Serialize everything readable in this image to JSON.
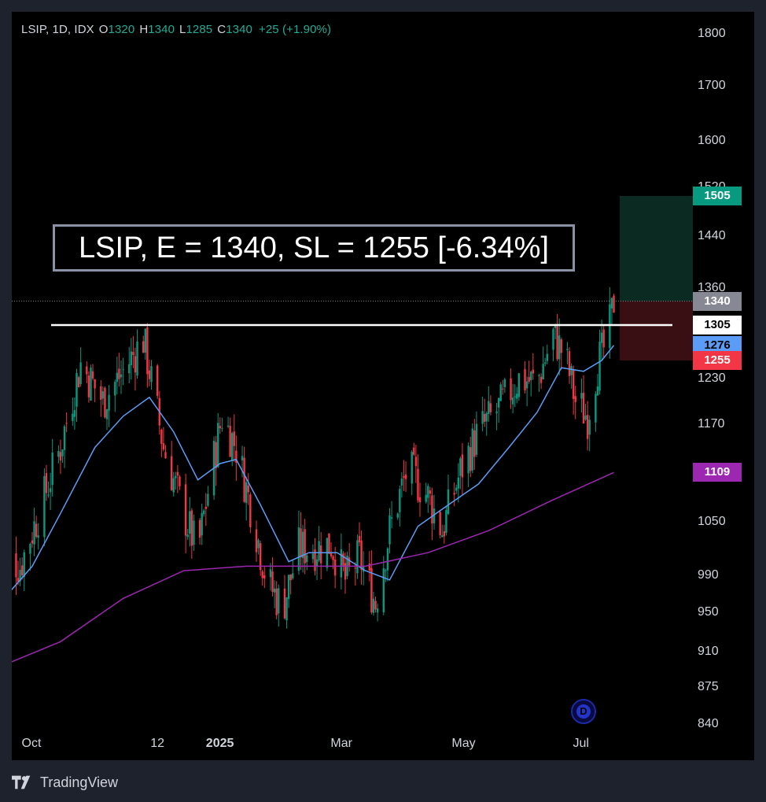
{
  "legend": {
    "symbol": "LSIP, 1D, IDX",
    "o_label": "O",
    "o_value": "1320",
    "h_label": "H",
    "h_value": "1340",
    "l_label": "L",
    "l_value": "1285",
    "c_label": "C",
    "c_value": "1340",
    "change": "+25 (+1.90%)"
  },
  "annotation": "LSIP, E = 1340, SL = 1255 [-6.34%]",
  "price_tags": [
    {
      "label": "1505",
      "value": 1505,
      "color": "#089981",
      "text_color": "#ffffff"
    },
    {
      "label": "1340",
      "value": 1340,
      "color": "#868993",
      "text_color": "#ffffff"
    },
    {
      "label": "1305",
      "value": 1305,
      "color": "#ffffff",
      "text_color": "#000000"
    },
    {
      "label": "1276",
      "value": 1276,
      "color": "#5b9cf6",
      "text_color": "#000000"
    },
    {
      "label": "1255",
      "value": 1255,
      "color": "#f23645",
      "text_color": "#ffffff"
    },
    {
      "label": "1109",
      "value": 1109,
      "color": "#9c27b0",
      "text_color": "#ffffff"
    }
  ],
  "footer": {
    "brand": "TradingView"
  },
  "colors": {
    "up": "#089981",
    "down": "#f23645",
    "ema_short": "#5b9cf6",
    "ema_long": "#9c27b0",
    "target_zone": "#0b2a22",
    "stop_zone": "#3a0f14",
    "resistance": "#ffffff"
  },
  "chart_data": {
    "type": "candlestick",
    "symbol": "LSIP",
    "interval": "1D",
    "exchange": "IDX",
    "y_scale": "log",
    "y_ticks": [
      {
        "label": "1800",
        "value": 1800
      },
      {
        "label": "1700",
        "value": 1700
      },
      {
        "label": "1600",
        "value": 1600
      },
      {
        "label": "1520",
        "value": 1520
      },
      {
        "label": "1440",
        "value": 1440
      },
      {
        "label": "1360",
        "value": 1360
      },
      {
        "label": "1230",
        "value": 1230
      },
      {
        "label": "1170",
        "value": 1170
      },
      {
        "label": "1050",
        "value": 1050
      },
      {
        "label": "990",
        "value": 990
      },
      {
        "label": "950",
        "value": 950
      },
      {
        "label": "910",
        "value": 910
      },
      {
        "label": "875",
        "value": 875
      },
      {
        "label": "840",
        "value": 840
      }
    ],
    "x_ticks": [
      {
        "label": "Oct",
        "date": "2024-10-01",
        "bold": false
      },
      {
        "label": "12",
        "date": "2024-12-02",
        "bold": false
      },
      {
        "label": "2025",
        "date": "2025-01-02",
        "bold": true
      },
      {
        "label": "Mar",
        "date": "2025-03-03",
        "bold": false
      },
      {
        "label": "May",
        "date": "2025-05-02",
        "bold": false
      },
      {
        "label": "Jul",
        "date": "2025-07-01",
        "bold": false
      }
    ],
    "resistance_level": 1305,
    "position": {
      "entry": 1340,
      "stop_loss": 1255,
      "target": 1505,
      "stop_pct": "-6.34%"
    },
    "close_series": [
      {
        "date": "2024-09-15",
        "close": 1020
      },
      {
        "date": "2024-09-25",
        "close": 1000
      },
      {
        "date": "2024-10-05",
        "close": 1065
      },
      {
        "date": "2024-10-15",
        "close": 1140
      },
      {
        "date": "2024-10-25",
        "close": 1250
      },
      {
        "date": "2024-11-05",
        "close": 1200
      },
      {
        "date": "2024-11-15",
        "close": 1240
      },
      {
        "date": "2024-11-25",
        "close": 1285
      },
      {
        "date": "2024-12-05",
        "close": 1140
      },
      {
        "date": "2024-12-15",
        "close": 1060
      },
      {
        "date": "2024-12-22",
        "close": 1015
      },
      {
        "date": "2024-12-28",
        "close": 1100
      },
      {
        "date": "2025-01-03",
        "close": 1180
      },
      {
        "date": "2025-01-10",
        "close": 1140
      },
      {
        "date": "2025-01-18",
        "close": 1060
      },
      {
        "date": "2025-01-25",
        "close": 985
      },
      {
        "date": "2025-02-02",
        "close": 955
      },
      {
        "date": "2025-02-10",
        "close": 1020
      },
      {
        "date": "2025-02-18",
        "close": 1020
      },
      {
        "date": "2025-02-26",
        "close": 1025
      },
      {
        "date": "2025-03-05",
        "close": 985
      },
      {
        "date": "2025-03-12",
        "close": 1010
      },
      {
        "date": "2025-03-20",
        "close": 960
      },
      {
        "date": "2025-03-27",
        "close": 1040
      },
      {
        "date": "2025-04-05",
        "close": 1115
      },
      {
        "date": "2025-04-15",
        "close": 1080
      },
      {
        "date": "2025-04-22",
        "close": 1040
      },
      {
        "date": "2025-05-01",
        "close": 1110
      },
      {
        "date": "2025-05-10",
        "close": 1160
      },
      {
        "date": "2025-05-20",
        "close": 1190
      },
      {
        "date": "2025-05-30",
        "close": 1230
      },
      {
        "date": "2025-06-08",
        "close": 1225
      },
      {
        "date": "2025-06-16",
        "close": 1290
      },
      {
        "date": "2025-06-22",
        "close": 1260
      },
      {
        "date": "2025-06-27",
        "close": 1200
      },
      {
        "date": "2025-07-03",
        "close": 1180
      },
      {
        "date": "2025-07-08",
        "close": 1250
      },
      {
        "date": "2025-07-13",
        "close": 1285
      },
      {
        "date": "2025-07-16",
        "close": 1340
      }
    ],
    "ema_short": [
      {
        "date": "2024-09-15",
        "value": 960
      },
      {
        "date": "2024-10-01",
        "value": 1000
      },
      {
        "date": "2024-10-15",
        "value": 1060
      },
      {
        "date": "2024-11-01",
        "value": 1140
      },
      {
        "date": "2024-11-15",
        "value": 1180
      },
      {
        "date": "2024-11-28",
        "value": 1205
      },
      {
        "date": "2024-12-10",
        "value": 1160
      },
      {
        "date": "2024-12-22",
        "value": 1100
      },
      {
        "date": "2025-01-02",
        "value": 1120
      },
      {
        "date": "2025-01-10",
        "value": 1125
      },
      {
        "date": "2025-01-22",
        "value": 1070
      },
      {
        "date": "2025-02-05",
        "value": 1005
      },
      {
        "date": "2025-02-15",
        "value": 1015
      },
      {
        "date": "2025-03-01",
        "value": 1015
      },
      {
        "date": "2025-03-15",
        "value": 995
      },
      {
        "date": "2025-03-27",
        "value": 985
      },
      {
        "date": "2025-04-10",
        "value": 1045
      },
      {
        "date": "2025-04-25",
        "value": 1070
      },
      {
        "date": "2025-05-10",
        "value": 1095
      },
      {
        "date": "2025-05-25",
        "value": 1140
      },
      {
        "date": "2025-06-08",
        "value": 1185
      },
      {
        "date": "2025-06-20",
        "value": 1245
      },
      {
        "date": "2025-07-01",
        "value": 1240
      },
      {
        "date": "2025-07-10",
        "value": 1255
      },
      {
        "date": "2025-07-16",
        "value": 1276
      }
    ],
    "ema_long": [
      {
        "date": "2024-09-15",
        "value": 895
      },
      {
        "date": "2024-10-15",
        "value": 920
      },
      {
        "date": "2024-11-15",
        "value": 965
      },
      {
        "date": "2024-12-15",
        "value": 995
      },
      {
        "date": "2025-01-15",
        "value": 1000
      },
      {
        "date": "2025-02-15",
        "value": 1000
      },
      {
        "date": "2025-03-15",
        "value": 1000
      },
      {
        "date": "2025-04-15",
        "value": 1015
      },
      {
        "date": "2025-05-15",
        "value": 1040
      },
      {
        "date": "2025-06-15",
        "value": 1075
      },
      {
        "date": "2025-07-16",
        "value": 1109
      }
    ]
  }
}
